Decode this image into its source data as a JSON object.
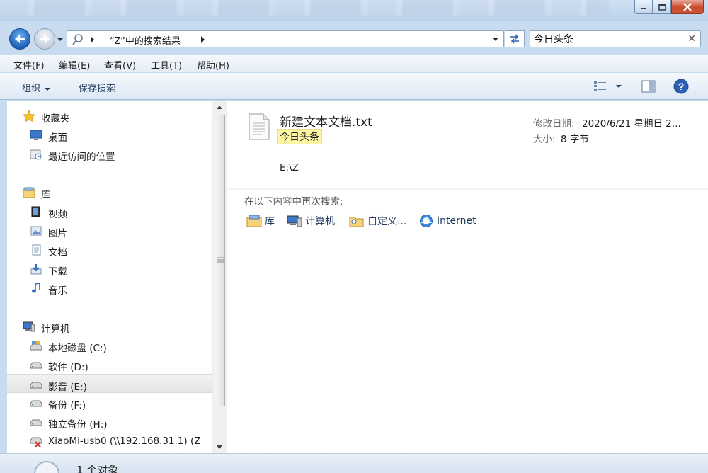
{
  "window": {
    "minimize_label": "minimize",
    "maximize_label": "maximize",
    "close_label": "close"
  },
  "address": {
    "path_segment": "“Z”中的搜索结果",
    "search_value": "今日头条"
  },
  "menu": [
    "文件(F)",
    "编辑(E)",
    "查看(V)",
    "工具(T)",
    "帮助(H)"
  ],
  "toolbar": {
    "organize": "组织",
    "save_search": "保存搜索"
  },
  "nav": {
    "favorites": "收藏夹",
    "desktop": "桌面",
    "recent": "最近访问的位置",
    "libraries": "库",
    "videos": "视频",
    "pictures": "图片",
    "documents": "文档",
    "downloads": "下载",
    "music": "音乐",
    "computer": "计算机",
    "drive_c": "本地磁盘 (C:)",
    "drive_d": "软件 (D:)",
    "drive_e": "影音 (E:)",
    "drive_f": "备份 (F:)",
    "drive_h": "独立备份 (H:)",
    "network_drive": "XiaoMi-usb0 (\\\\192.168.31.1) (Z"
  },
  "result": {
    "file_name": "新建文本文档.txt",
    "match_text": "今日头条",
    "modified_label": "修改日期:",
    "modified_value": "2020/6/21 星期日 2...",
    "size_label": "大小:",
    "size_value": "8 字节",
    "path": "E:\\Z"
  },
  "search_again": {
    "heading": "在以下内容中再次搜索:",
    "items": [
      "库",
      "计算机",
      "自定义...",
      "Internet"
    ]
  },
  "status": {
    "count": "1 个对象"
  }
}
